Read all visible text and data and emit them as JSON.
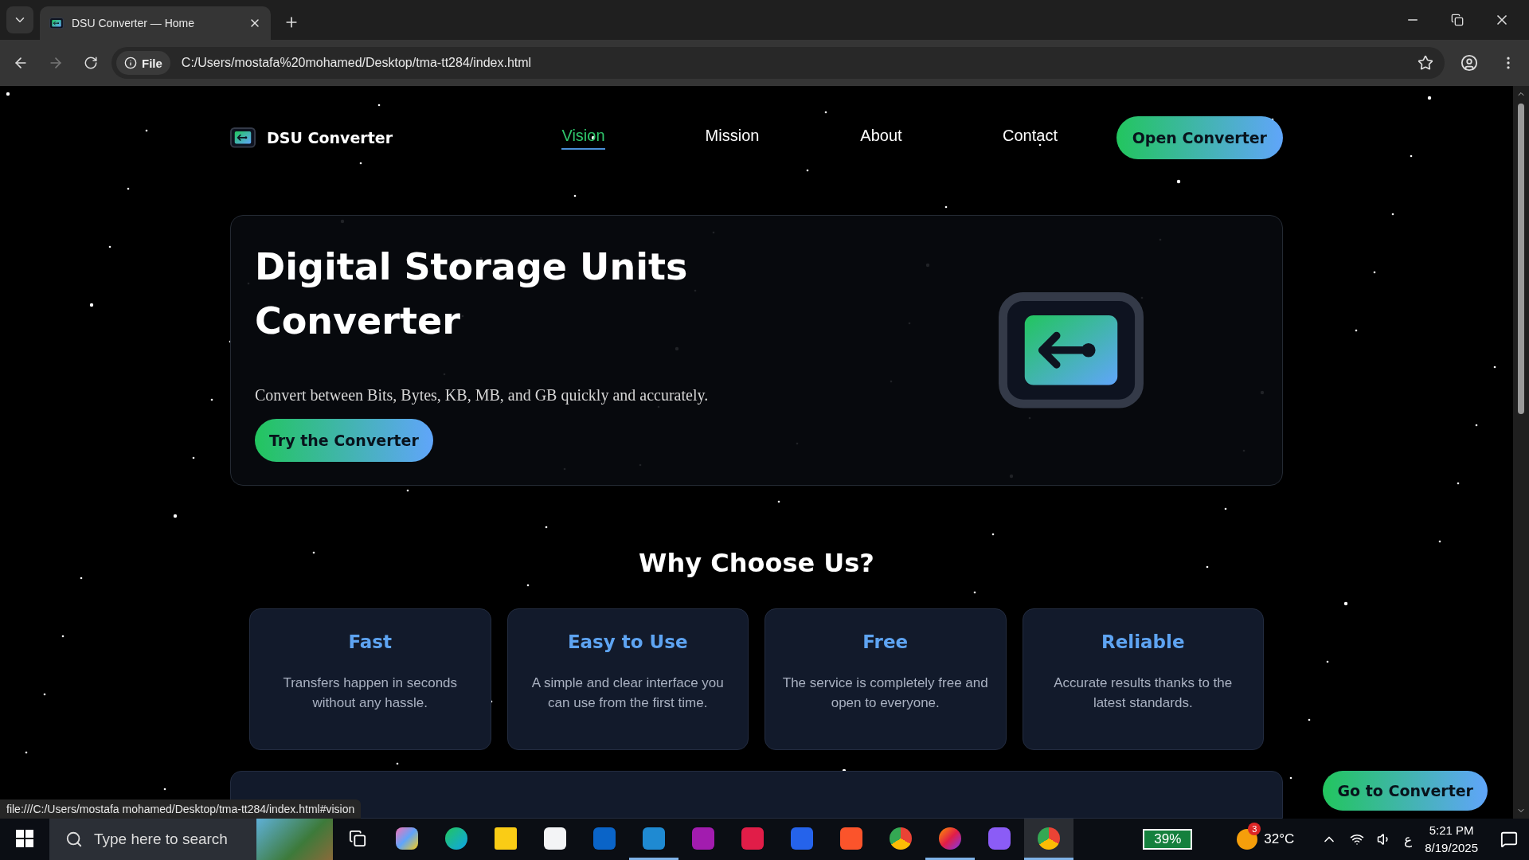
{
  "browser": {
    "tab_title": "DSU Converter — Home",
    "site_chip": "File",
    "url": "C:/Users/mostafa%20mohamed/Desktop/tma-tt284/index.html"
  },
  "header": {
    "brand": "DSU Converter",
    "nav": [
      {
        "label": "Vision",
        "selected": true
      },
      {
        "label": "Mission",
        "selected": false
      },
      {
        "label": "About",
        "selected": false
      },
      {
        "label": "Contact",
        "selected": false
      }
    ],
    "cta": "Open Converter"
  },
  "hero": {
    "title": "Digital Storage Units Converter",
    "subtitle": "Convert between Bits, Bytes, KB, MB, and GB quickly and accurately.",
    "button": "Try the Converter"
  },
  "features": {
    "heading": "Why Choose Us?",
    "cards": [
      {
        "title": "Fast",
        "text": "Transfers happen in seconds without any hassle."
      },
      {
        "title": "Easy to Use",
        "text": "A simple and clear interface you can use from the first time."
      },
      {
        "title": "Free",
        "text": "The service is completely free and open to everyone."
      },
      {
        "title": "Reliable",
        "text": "Accurate results thanks to the latest standards."
      }
    ]
  },
  "floating_button": "Go to Converter",
  "status_url": "file:///C:/Users/mostafa mohamed/Desktop/tma-tt284/index.html#vision",
  "taskbar": {
    "search_placeholder": "Type here to search",
    "battery": "39%",
    "weather_badge": "3",
    "temperature": "32°C",
    "input_language": "ع",
    "time": "5:21 PM",
    "date": "8/19/2025"
  }
}
